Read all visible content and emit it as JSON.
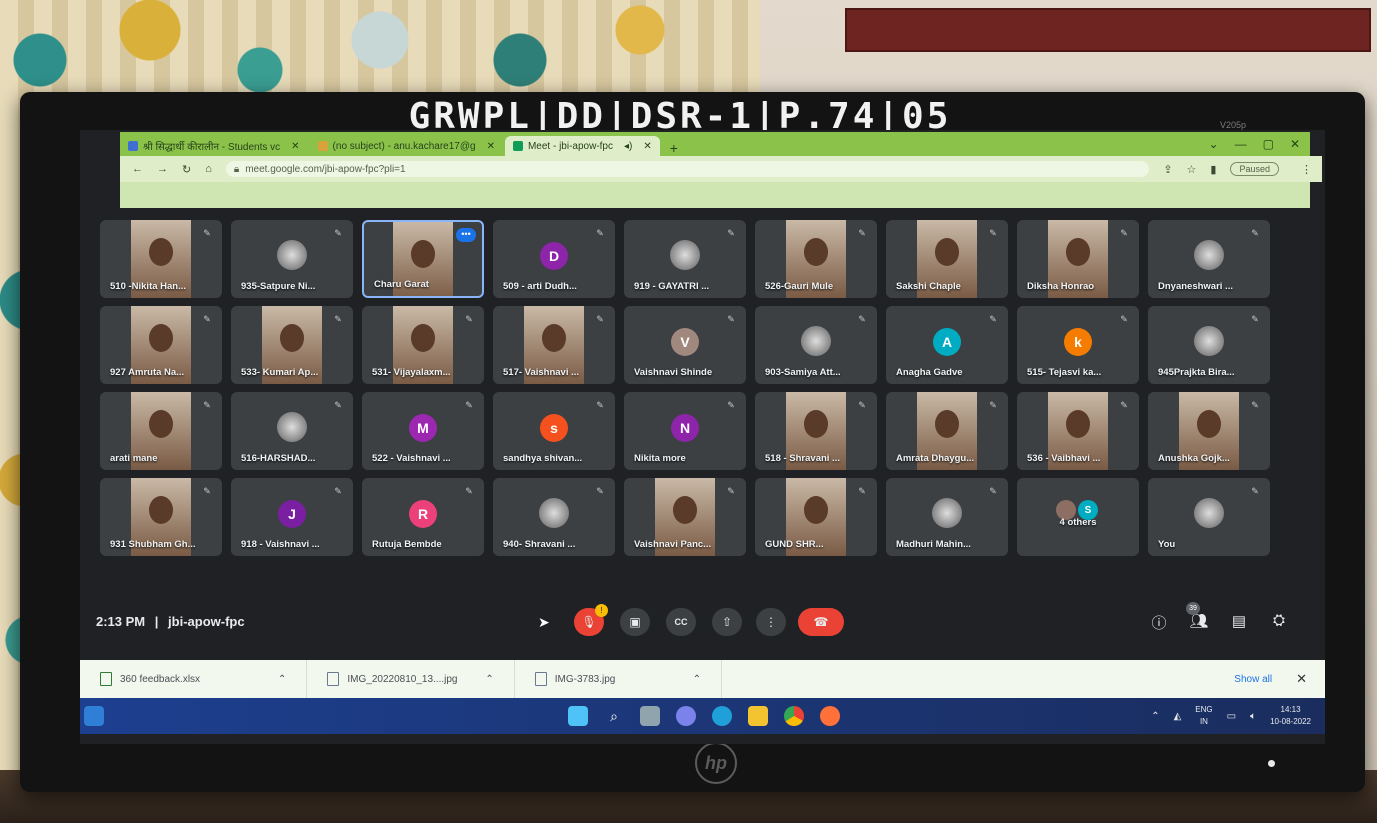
{
  "scene": {
    "tape_label": "GRWPL|DD|DSR-1|P.74|05",
    "monitor_model": "V205p",
    "monitor_brand": "hp"
  },
  "browser": {
    "tabs": [
      {
        "label": "श्री सिद्धार्थी कीरालीन - Students vc",
        "icon": "school-icon",
        "active": false,
        "color": "#3f6fd1"
      },
      {
        "label": "(no subject) - anu.kachare17@g",
        "icon": "mail-icon",
        "active": false,
        "color": "#d7a33a"
      },
      {
        "label": "Meet - jbi-apow-fpc",
        "icon": "meet-icon",
        "active": true,
        "color": "#0f9d58"
      }
    ],
    "url": "meet.google.com/jbi-apow-fpc?pli=1",
    "profile_status": "Paused"
  },
  "participants": [
    {
      "name": "510 -Nikita Han...",
      "kind": "photo"
    },
    {
      "name": "935-Satpure Ni...",
      "kind": "round"
    },
    {
      "name": "Charu Garat",
      "kind": "photo",
      "active": true
    },
    {
      "name": "509 - arti Dudh...",
      "kind": "letter",
      "letter": "D",
      "color": "#8e24aa"
    },
    {
      "name": "919 - GAYATRI ...",
      "kind": "round"
    },
    {
      "name": "526-Gauri Mule",
      "kind": "photo"
    },
    {
      "name": "Sakshi Chaple",
      "kind": "photo"
    },
    {
      "name": "Diksha Honrao",
      "kind": "photo"
    },
    {
      "name": "Dnyaneshwari ...",
      "kind": "round"
    },
    {
      "name": "927 Amruta Na...",
      "kind": "photo"
    },
    {
      "name": "533- Kumari Ap...",
      "kind": "photo"
    },
    {
      "name": "531- Vijayalaxm...",
      "kind": "photo"
    },
    {
      "name": "517- Vaishnavi ...",
      "kind": "photo"
    },
    {
      "name": "Vaishnavi Shinde",
      "kind": "letter",
      "letter": "V",
      "color": "#a1887f"
    },
    {
      "name": "903-Samiya Att...",
      "kind": "round"
    },
    {
      "name": "Anagha Gadve",
      "kind": "letter",
      "letter": "A",
      "color": "#00acc1"
    },
    {
      "name": "515- Tejasvi ka...",
      "kind": "letter",
      "letter": "k",
      "color": "#f57c00"
    },
    {
      "name": "945Prajkta Bira...",
      "kind": "round"
    },
    {
      "name": "arati mane",
      "kind": "photo"
    },
    {
      "name": "516-HARSHAD...",
      "kind": "round"
    },
    {
      "name": "522 - Vaishnavi ...",
      "kind": "letter",
      "letter": "M",
      "color": "#9c27b0"
    },
    {
      "name": "sandhya shivan...",
      "kind": "letter",
      "letter": "s",
      "color": "#f4511e"
    },
    {
      "name": "Nikita more",
      "kind": "letter",
      "letter": "N",
      "color": "#8e24aa"
    },
    {
      "name": "518 - Shravani ...",
      "kind": "photo"
    },
    {
      "name": "Amrata Dhaygu...",
      "kind": "photo"
    },
    {
      "name": "536 - Vaibhavi ...",
      "kind": "photo"
    },
    {
      "name": "Anushka Gojk...",
      "kind": "photo"
    },
    {
      "name": "931 Shubham Gh...",
      "kind": "photo"
    },
    {
      "name": "918 - Vaishnavi ...",
      "kind": "letter",
      "letter": "J",
      "color": "#7b1fa2"
    },
    {
      "name": "Rutuja Bembde",
      "kind": "letter",
      "letter": "R",
      "color": "#ec407a"
    },
    {
      "name": "940- Shravani ...",
      "kind": "round"
    },
    {
      "name": "Vaishnavi Panc...",
      "kind": "photo"
    },
    {
      "name": "GUND SHR...",
      "kind": "photo"
    },
    {
      "name": "Madhuri Mahin...",
      "kind": "round"
    },
    {
      "name": "4 others",
      "kind": "others"
    },
    {
      "name": "You",
      "kind": "round"
    }
  ],
  "meeting": {
    "time": "2:13 PM",
    "separator": "|",
    "code": "jbi-apow-fpc",
    "mic_badge": "!",
    "participant_count": "39"
  },
  "controls": {
    "captions_icon": "CC",
    "more_icon": "⋮"
  },
  "downloads": [
    {
      "name": "360 feedback.xlsx"
    },
    {
      "name": "IMG_20220810_13....jpg"
    },
    {
      "name": "IMG-3783.jpg"
    }
  ],
  "downloads_show_all": "Show all",
  "taskbar": {
    "lang_top": "ENG",
    "lang_bottom": "IN",
    "clock_time": "14:13",
    "clock_date": "10-08-2022"
  },
  "colors": {
    "accent_blue": "#1a73e8",
    "end_call_red": "#ea4335",
    "tile_bg": "#3c4043",
    "browser_theme": "#8bc34a"
  }
}
